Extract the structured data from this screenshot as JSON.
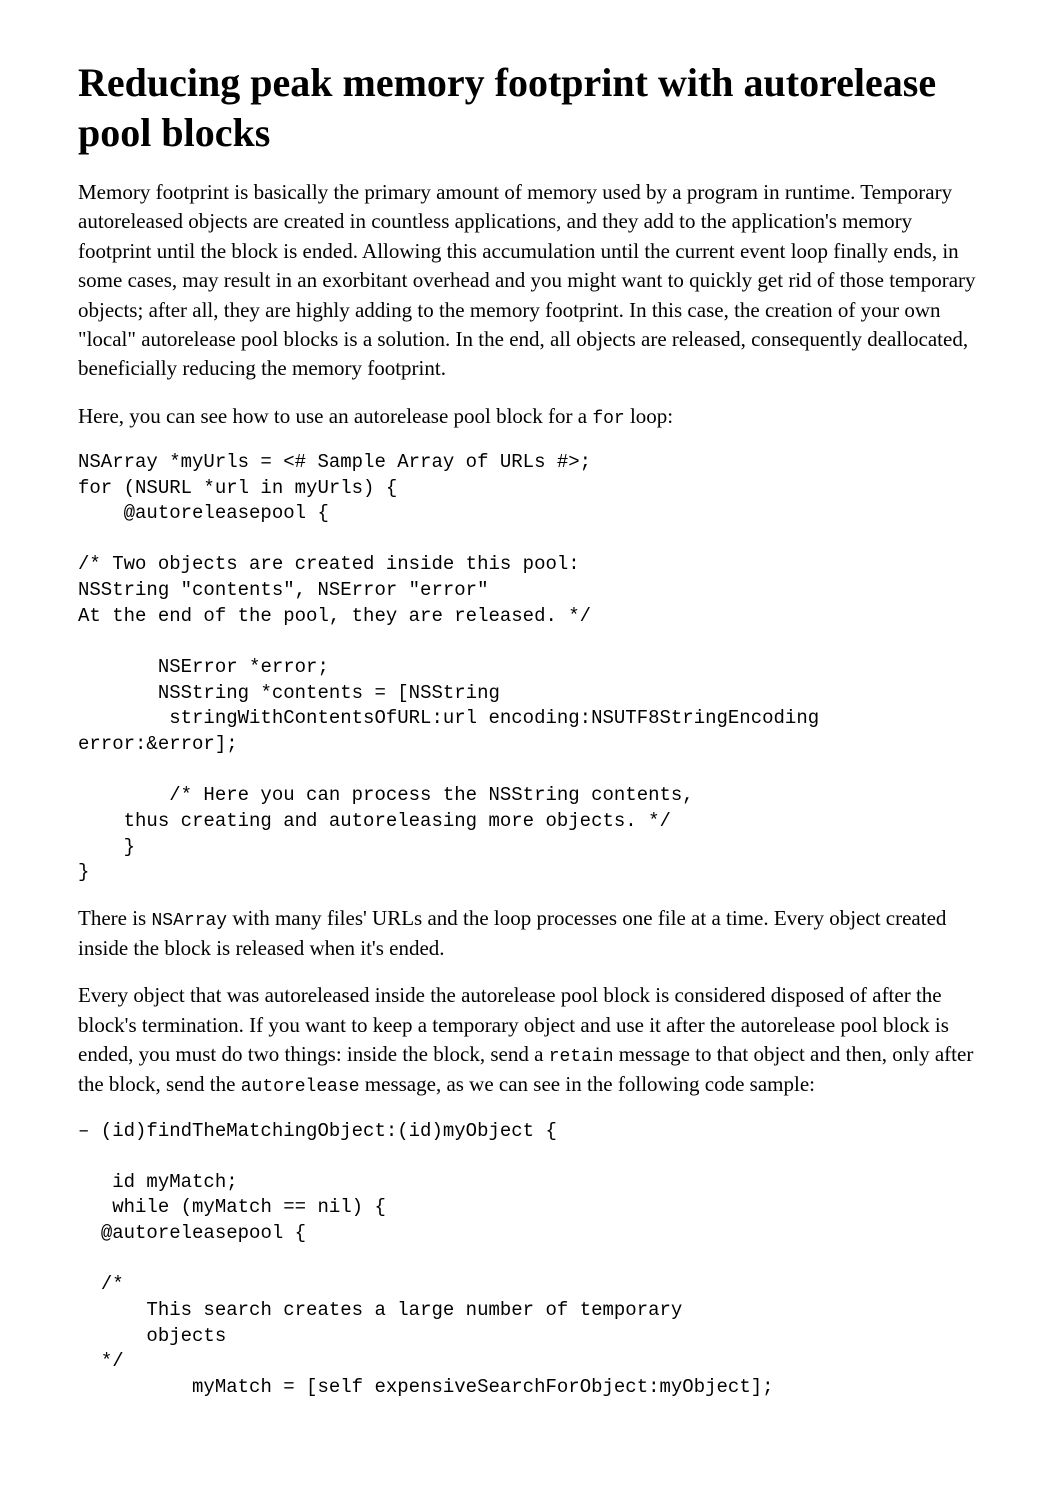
{
  "title": "Reducing peak memory footprint with autorelease pool blocks",
  "para1": "Memory footprint is basically the primary amount of memory used by a program in runtime. Temporary autoreleased objects are created in countless applications, and they add to the application's memory footprint until the block is ended. Allowing this accumulation until the current event loop finally ends, in some cases, may result in an exorbitant overhead and you might want to quickly get rid of those temporary objects; after all, they are highly adding to the memory footprint. In this case, the creation of your own \"local\" autorelease pool blocks is a solution. In the end, all objects are released, consequently deallocated, beneficially reducing the memory footprint.",
  "para2_a": "Here, you can see how to use an autorelease pool block for a ",
  "para2_code": "for",
  "para2_b": " loop:",
  "code1": "NSArray *myUrls = <# Sample Array of URLs #>;\nfor (NSURL *url in myUrls) {\n    @autoreleasepool {\n\n/* Two objects are created inside this pool:\nNSString \"contents\", NSError \"error\"\nAt the end of the pool, they are released. */\n\n       NSError *error;\n       NSString *contents = [NSString\n        stringWithContentsOfURL:url encoding:NSUTF8StringEncoding error:&error];\n\n        /* Here you can process the NSString contents,\n    thus creating and autoreleasing more objects. */\n    }\n}",
  "para3_a": "There is ",
  "para3_code": "NSArray",
  "para3_b": " with many files' URLs and the loop processes one file at a time. Every object created inside the block is released when it's ended.",
  "para4_a": "Every object that was autoreleased inside the autorelease pool block is considered disposed of after the block's termination. If you want to keep a temporary object and use it after the autorelease pool block is ended, you must do two things: inside the block, send a ",
  "para4_code1": "retain",
  "para4_b": " message to that object and then, only after the block, send the ",
  "para4_code2": "autorelease",
  "para4_c": " message, as we can see in the following code sample:",
  "code2": "– (id)findTheMatchingObject:(id)myObject {\n\n   id myMatch;\n   while (myMatch == nil) {\n  @autoreleasepool {\n\n  /*\n      This search creates a large number of temporary     \n      objects\n  */\n          myMatch = [self expensiveSearchForObject:myObject];"
}
